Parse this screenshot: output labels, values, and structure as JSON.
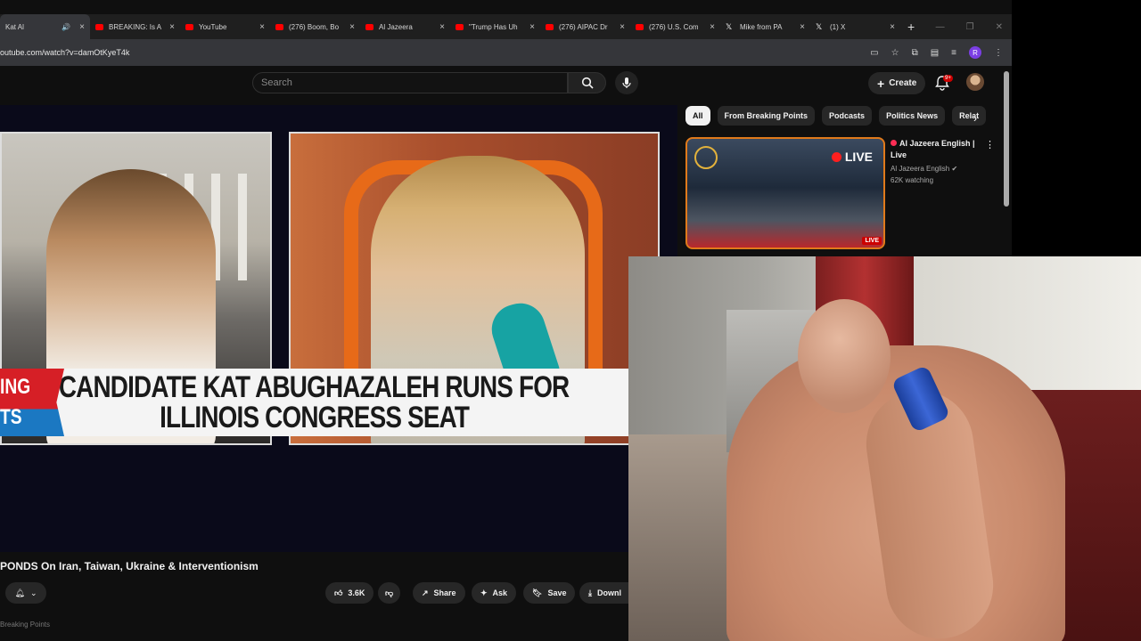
{
  "browser": {
    "tabs": [
      {
        "title": "Kat Al",
        "favicon": "youtube-icon",
        "active": true,
        "audio": true
      },
      {
        "title": "BREAKING: Is A",
        "favicon": "youtube-icon"
      },
      {
        "title": "YouTube",
        "favicon": "youtube-icon"
      },
      {
        "title": "(276) Boom, Bo",
        "favicon": "youtube-icon"
      },
      {
        "title": "Al Jazeera",
        "favicon": "youtube-icon"
      },
      {
        "title": "\"Trump Has Uh",
        "favicon": "youtube-icon"
      },
      {
        "title": "(276) AIPAC Dr",
        "favicon": "youtube-icon"
      },
      {
        "title": "(276) U.S. Com",
        "favicon": "youtube-icon"
      },
      {
        "title": "Mike from PA",
        "favicon": "x-icon"
      },
      {
        "title": "(1) X",
        "favicon": "x-icon"
      }
    ],
    "url": "outube.com/watch?v=damOtKyeT4k",
    "profile_initial": "R"
  },
  "youtube": {
    "search_placeholder": "Search",
    "create_label": "Create",
    "notification_badge": "9+",
    "chips": [
      "All",
      "From Breaking Points",
      "Podcasts",
      "Politics News",
      "Relat"
    ],
    "recommendation": {
      "title": "Al Jazeera English | Live",
      "channel": "Al Jazeera English",
      "meta": "62K watching",
      "live_label": "LIVE",
      "live_badge": "LIVE"
    },
    "video": {
      "lower_third_line1": "CANDIDATE KAT ABUGHAZALEH RUNS FOR",
      "lower_third_line2": "ILLINOIS CONGRESS SEAT",
      "breaking_line1": "ING",
      "breaking_line2": "TS",
      "title": "PONDS On Iran, Taiwan, Ukraine & Interventionism"
    },
    "actions": {
      "like_count": "3.6K",
      "share": "Share",
      "ask": "Ask",
      "save": "Save",
      "download": "Downl"
    },
    "channel_line": "Breaking Points"
  },
  "colors": {
    "youtube_red": "#ff0000",
    "breaking_red": "#d61f26",
    "breaking_blue": "#1b78c2",
    "chip_active": "#f1f1f1"
  }
}
